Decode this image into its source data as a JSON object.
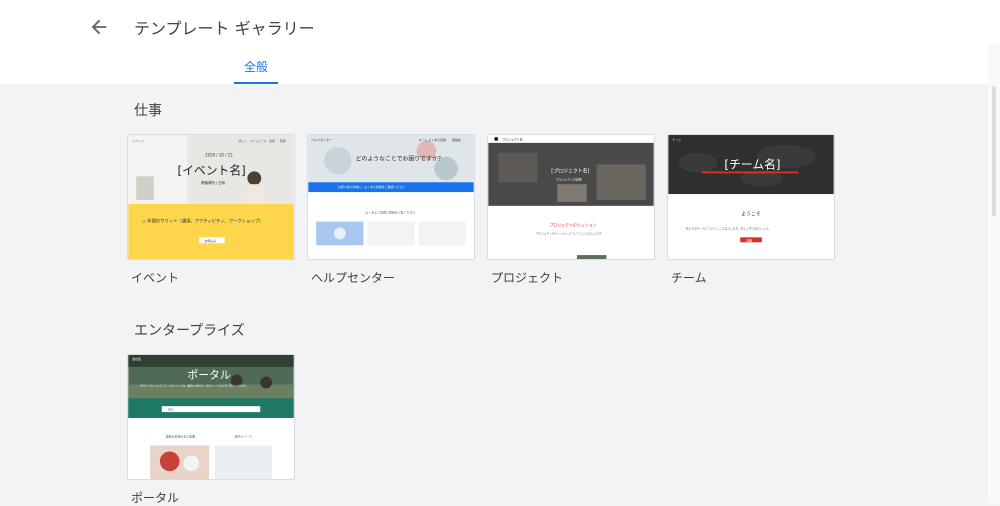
{
  "header": {
    "title": "テンプレート ギャラリー",
    "back_icon": "arrow-back-icon"
  },
  "tabs": [
    {
      "label": "全般",
      "selected": true
    }
  ],
  "sections": [
    {
      "title": "仕事",
      "templates": [
        {
          "label": "イベント",
          "preview": {
            "nav_left": "イベント",
            "nav_items": [
              "詳しく",
              "スケジュール",
              "会場",
              "登録"
            ],
            "date": "2020 / 10 / 15",
            "title": "[イベント名]",
            "subtitle": "開催場所 | 日時 ",
            "summary": "○ 年間のサミット（講演、アクティビティ、ワークショップ）",
            "button": "お申込み"
          }
        },
        {
          "label": "ヘルプセンター",
          "preview": {
            "nav_left": "ヘルプセンター",
            "nav_items": [
              "ホーム",
              "よくある質問",
              "連絡先"
            ],
            "headline": "どのようなことでお困りですか？",
            "banner": "お問い合わせ前に、よくある質問をご確認ください",
            "list_heading": "よくあるご質問と回答をご覧ください",
            "tiles": [
              "",
              "",
              ""
            ]
          }
        },
        {
          "label": "プロジェクト",
          "preview": {
            "nav_left": "プロジェクト名",
            "title": "[プロジェクト名]",
            "subtitle": "プロジェクトの説明",
            "mission_heading": "プロジェクトのミッション",
            "mission_text": "プロジェクトのミッションについてここに記入します"
          }
        },
        {
          "label": "チーム",
          "preview": {
            "nav_left": "チーム",
            "title": "[チーム名]",
            "welcome": "ようこそ",
            "text": "私たちのチームについてここに記入します。詳しく見てみましょう。",
            "button": "詳細"
          }
        }
      ]
    },
    {
      "title": "エンタープライズ",
      "templates": [
        {
          "label": "ポータル",
          "preview": {
            "nav_left": "会社名",
            "title": "ポータル",
            "subtitle": "社内ポータルへようこそ。このサイトでは、最新のお知らせ、社内リソースなどをご覧いただけます。",
            "search_placeholder": "検索",
            "col1": "最新のお知らせと記事",
            "col2": "社内リソース"
          }
        }
      ]
    }
  ],
  "colors": {
    "accent": "#1a73e8",
    "event_yellow": "#fdd64b",
    "help_blue": "#1a73e8",
    "project_red": "#c5221f",
    "team_red": "#d93025",
    "portal_green": "#1e7a66"
  }
}
